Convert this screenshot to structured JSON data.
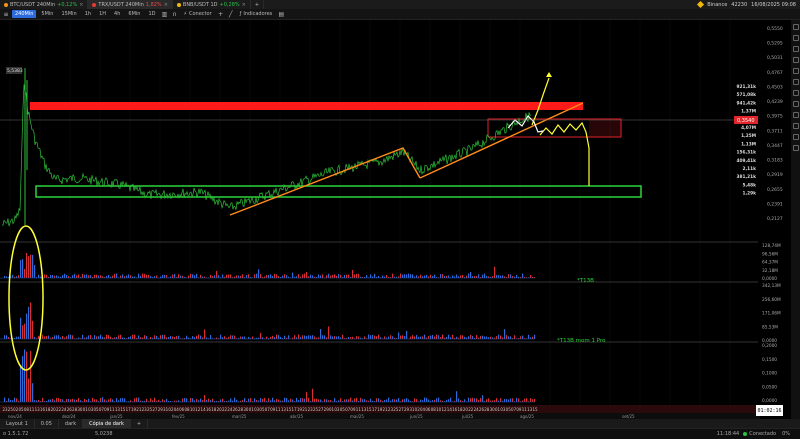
{
  "tabs": [
    {
      "label": "BTC/USDT 240Min",
      "change": "+0,12%",
      "change_dir": "pos",
      "dot": "#f7931a",
      "active": false
    },
    {
      "label": "TRX/USDT 240Min",
      "change": "1,82%",
      "change_dir": "neg",
      "dot": "#e53935",
      "active": true
    },
    {
      "label": "BNB/USDT 1D",
      "change": "+0,28%",
      "change_dir": "pos",
      "dot": "#f0b90b",
      "active": false
    }
  ],
  "topright": {
    "exchange": "Binance",
    "balance": "42230",
    "datetime": "16/08/2025 09:08"
  },
  "toolbar": {
    "timeframes": [
      "240Min",
      "5Min",
      "15Min",
      "1h",
      "1H",
      "4h",
      "6Min",
      "1D"
    ],
    "active_timeframe": "240Min",
    "connector_label": "Conector",
    "indicators_label": "Indicadores"
  },
  "price_axis": {
    "labels": [
      "0,5550",
      "0,5295",
      "0,5031",
      "0,4767",
      "0,4503",
      "0,4239",
      "0,3975",
      "0,3711",
      "0,3447",
      "0,3183",
      "0,2919",
      "0,2655",
      "0,2391",
      "0,2127"
    ],
    "current_price": "0,3540",
    "stack_labels": [
      "921,31k",
      "571,08k",
      "941,42k",
      "1,37M",
      "357,68k",
      "4,07M",
      "1,25M",
      "1,13M",
      "156,31k",
      "409,41k",
      "2,11k",
      "381,21k",
      "5,48k",
      "1,29k"
    ]
  },
  "vol1_axis": {
    "labels": [
      "128,74M",
      "96,56M",
      "64,37M",
      "32,18M",
      "0,0000"
    ]
  },
  "vol2_axis": {
    "labels": [
      "342,13M",
      "256,60M",
      "171,06M",
      "85,53M",
      "0,0000"
    ]
  },
  "vol3_axis": {
    "labels": [
      "0,2000",
      "0,1500",
      "0,1000",
      "0,0500",
      "0,0000"
    ]
  },
  "panel_labels": {
    "vol1": "*T13B",
    "vol2": "*T13B mom 1 Pro"
  },
  "chart_label": "5,5383",
  "x_axis": {
    "month_labels": [
      "nov/24",
      "dez/24",
      "jan/25",
      "fev/25",
      "mar/25",
      "abr/25",
      "mai/25",
      "jun/25",
      "jul/25",
      "ago/25",
      "set/25"
    ],
    "day_labels": [
      "23",
      "25",
      "02",
      "05",
      "08",
      "11",
      "13",
      "16",
      "18",
      "20",
      "22",
      "24",
      "26",
      "28",
      "30",
      "01",
      "03",
      "05",
      "07",
      "09",
      "11",
      "13",
      "15",
      "17",
      "19",
      "21",
      "23",
      "25",
      "27",
      "29",
      "31",
      "02",
      "04",
      "06",
      "08",
      "10",
      "12",
      "14",
      "16",
      "18",
      "20",
      "22",
      "24",
      "26",
      "28",
      "30",
      "01",
      "03",
      "05",
      "07",
      "09",
      "11",
      "13",
      "15",
      "17",
      "19",
      "21",
      "23",
      "25",
      "27",
      "29",
      "01",
      "03",
      "05",
      "07",
      "09",
      "11",
      "13",
      "15",
      "17",
      "19",
      "21",
      "23",
      "25",
      "27",
      "29",
      "31",
      "02",
      "04",
      "06",
      "08",
      "10",
      "12",
      "14",
      "16",
      "18",
      "20",
      "22",
      "24",
      "26",
      "28",
      "30",
      "01",
      "03",
      "05",
      "07",
      "09",
      "11",
      "13",
      "15"
    ]
  },
  "clock": "01:02:16",
  "layout_tabs": [
    "Layout 1",
    "0.05",
    "dark",
    "Cópia de dark"
  ],
  "active_layout": "Cópia de dark",
  "status": {
    "left": "o 1.5.1.72",
    "value": "5,0238",
    "time": "11:18:44",
    "connection": "Conectado",
    "percent": "0%"
  },
  "colors": {
    "bg": "#000000",
    "candle_line": "#2fbf3a",
    "resistance": "#ff1a1a",
    "support_box": "#2ad43a",
    "trend": "#ff8c1a",
    "forecast": "#ffff33",
    "ellipse": "#ffff33",
    "red_box": "#e0242a"
  }
}
